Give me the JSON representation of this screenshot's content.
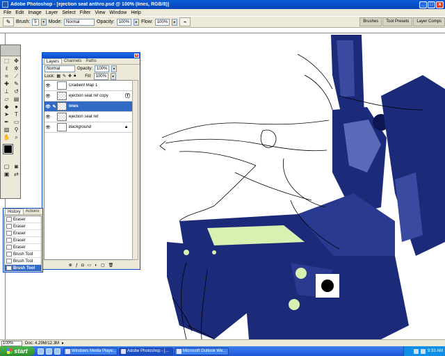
{
  "window": {
    "title": "Adobe Photoshop - [ejection seat anthro.psd @ 100% (lines, RGB/8)]",
    "buttons": [
      "_",
      "□",
      "x"
    ]
  },
  "menu": [
    "File",
    "Edit",
    "Image",
    "Layer",
    "Select",
    "Filter",
    "View",
    "Window",
    "Help"
  ],
  "options": {
    "brush_label": "Brush:",
    "brush_size": "5",
    "mode_label": "Mode:",
    "mode_value": "Normal",
    "opacity_label": "Opacity:",
    "opacity_value": "100%",
    "flow_label": "Flow:",
    "flow_value": "100%"
  },
  "palette_well": [
    "Brushes",
    "Tool Presets",
    "Layer Comps"
  ],
  "layers_palette": {
    "tabs": [
      "Layers",
      "Channels",
      "Paths"
    ],
    "blend_mode": "Normal",
    "opacity_label": "Opacity:",
    "opacity_value": "100%",
    "lock_label": "Lock:",
    "fill_label": "Fill:",
    "fill_value": "100%",
    "layers": [
      {
        "name": "Gradient Map 1",
        "visible": true,
        "selected": false
      },
      {
        "name": "ejection seat ref copy",
        "visible": true,
        "selected": false
      },
      {
        "name": "lines",
        "visible": true,
        "selected": true
      },
      {
        "name": "ejection seat ref",
        "visible": true,
        "selected": false
      },
      {
        "name": "Background",
        "visible": true,
        "selected": false,
        "locked": true
      }
    ]
  },
  "history_palette": {
    "tabs": [
      "History",
      "Actions"
    ],
    "items": [
      {
        "label": "Eraser",
        "selected": false
      },
      {
        "label": "Eraser",
        "selected": false
      },
      {
        "label": "Eraser",
        "selected": false
      },
      {
        "label": "Eraser",
        "selected": false
      },
      {
        "label": "Eraser",
        "selected": false
      },
      {
        "label": "Brush Tool",
        "selected": false
      },
      {
        "label": "Brush Tool",
        "selected": false
      },
      {
        "label": "Brush Tool",
        "selected": true
      }
    ]
  },
  "status": {
    "zoom": "100%",
    "doc": "Doc: 4.29M/12.3M"
  },
  "taskbar": {
    "start": "start",
    "tasks": [
      "Windows Media Playe...",
      "Adobe Photoshop - [...",
      "Microsoft Outlook We..."
    ],
    "active_task": 1,
    "clock": "9:33 AM"
  },
  "colors": {
    "titlebar": "#0a5ed8",
    "selection": "#316ac5",
    "artwork_navy": "#1c2a7a",
    "artwork_highlight": "#d8f0b0"
  }
}
